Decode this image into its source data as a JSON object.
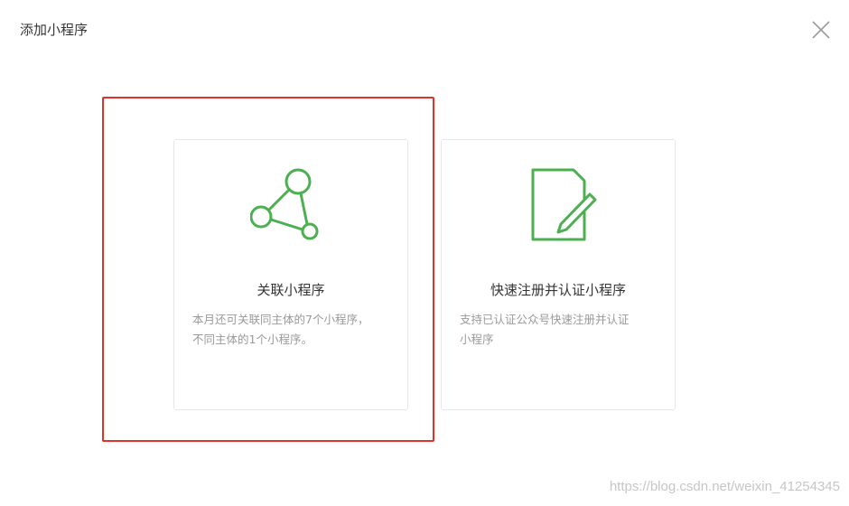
{
  "dialog": {
    "title": "添加小程序",
    "close_icon": "close-icon"
  },
  "cards": [
    {
      "icon": "network-nodes-icon",
      "title": "关联小程序",
      "desc_lines": [
        "本月还可关联同主体的7个小程序，",
        "不同主体的1个小程序。"
      ],
      "selected": true
    },
    {
      "icon": "document-pencil-icon",
      "title": "快速注册并认证小程序",
      "desc_lines": [
        "支持已认证公众号快速注册并认证",
        "小程序"
      ],
      "selected": false
    }
  ],
  "colors": {
    "accent_green": "#4caf50",
    "highlight_red": "#e3302b",
    "text_primary": "#353535",
    "text_secondary": "#9a9a9a",
    "card_border": "#e4e8eb"
  },
  "watermark": "https://blog.csdn.net/weixin_41254345"
}
